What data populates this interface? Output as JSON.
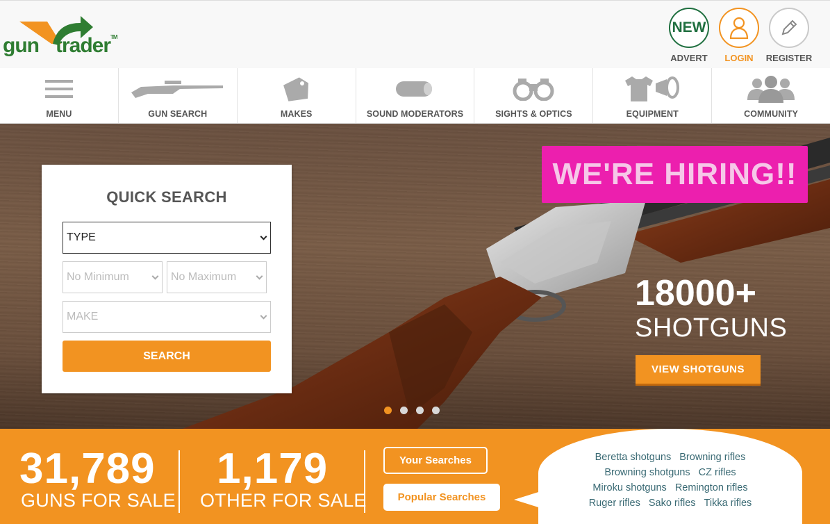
{
  "header": {
    "logo_gun": "gun",
    "logo_trader": "trader",
    "logo_tm": "TM",
    "new_circle": "NEW",
    "new_label": "ADVERT",
    "login_label": "LOGIN",
    "register_label": "REGISTER"
  },
  "nav": {
    "items": [
      {
        "label": "MENU",
        "icon": "hamburger-icon"
      },
      {
        "label": "GUN SEARCH",
        "icon": "rifle-icon"
      },
      {
        "label": "MAKES",
        "icon": "tag-icon"
      },
      {
        "label": "SOUND MODERATORS",
        "icon": "moderator-icon"
      },
      {
        "label": "SIGHTS & OPTICS",
        "icon": "binoculars-icon"
      },
      {
        "label": "EQUIPMENT",
        "icon": "equipment-icon"
      },
      {
        "label": "COMMUNITY",
        "icon": "community-icon"
      }
    ]
  },
  "quick_search": {
    "title": "QUICK SEARCH",
    "type_value": "TYPE",
    "min_value": "No Minimum",
    "max_value": "No Maximum",
    "make_value": "MAKE",
    "search_button": "SEARCH"
  },
  "hero": {
    "hiring": "WE'RE HIRING!!",
    "count": "18000+",
    "count_label": "SHOTGUNS",
    "cta": "VIEW SHOTGUNS",
    "slides": 4,
    "active_slide": 1
  },
  "band": {
    "guns_count": "31,789",
    "guns_label": "GUNS FOR SALE",
    "other_count": "1,179",
    "other_label": "OTHER FOR SALE",
    "your_searches": "Your Searches",
    "popular_searches": "Popular Searches",
    "links_row1": [
      "Beretta shotguns",
      "Browning rifles"
    ],
    "links_row2": [
      "Browning shotguns",
      "CZ rifles"
    ],
    "links_row3": [
      "Miroku shotguns",
      "Remington rifles"
    ],
    "links_row4": [
      "Ruger rifles",
      "Sako rifles",
      "Tikka rifles"
    ]
  },
  "colors": {
    "accent": "#f29321",
    "brand_green": "#2f7d32",
    "hiring_pink": "#ec1fae"
  }
}
